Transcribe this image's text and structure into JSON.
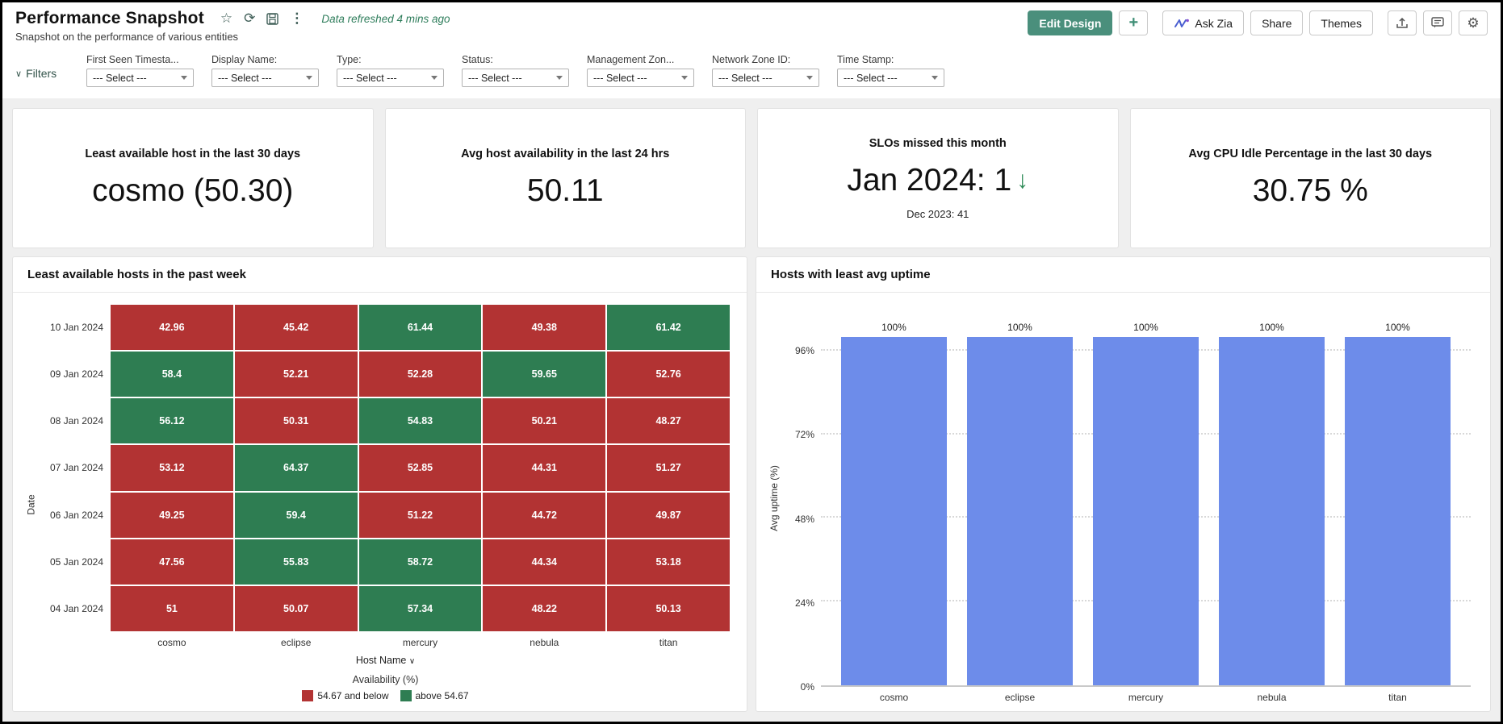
{
  "header": {
    "title": "Performance Snapshot",
    "subtitle": "Snapshot on the performance of various entities",
    "refresh_status": "Data refreshed 4 mins ago",
    "buttons": {
      "edit_design": "Edit Design",
      "add": "+",
      "ask_zia": "Ask Zia",
      "share": "Share",
      "themes": "Themes"
    },
    "icons": [
      "star-icon",
      "refresh-icon",
      "save-icon",
      "kebab-menu-icon",
      "export-icon",
      "comment-icon",
      "gear-icon"
    ]
  },
  "filters": {
    "label": "Filters",
    "select_placeholder": "--- Select ---",
    "fields": [
      "First Seen Timesta...",
      "Display Name:",
      "Type:",
      "Status:",
      "Management Zon...",
      "Network Zone ID:",
      "Time Stamp:"
    ]
  },
  "kpi_cards": [
    {
      "title": "Least available host in the last 30 days",
      "value": "cosmo (50.30)",
      "trend": "",
      "subtext": ""
    },
    {
      "title": "Avg host availability in the last 24 hrs",
      "value": "50.11",
      "trend": "",
      "subtext": ""
    },
    {
      "title": "SLOs missed this month",
      "value": "Jan 2024: 1",
      "trend": "down",
      "subtext": "Dec 2023: 41"
    },
    {
      "title": "Avg CPU Idle Percentage in the last 30 days",
      "value": "30.75 %",
      "trend": "",
      "subtext": ""
    }
  ],
  "chart_data": [
    {
      "type": "heatmap",
      "title": "Least available hosts in the past week",
      "xlabel": "Host Name",
      "ylabel": "Date",
      "columns": [
        "cosmo",
        "eclipse",
        "mercury",
        "nebula",
        "titan"
      ],
      "rows": [
        "10 Jan 2024",
        "09 Jan 2024",
        "08 Jan 2024",
        "07 Jan 2024",
        "06 Jan 2024",
        "05 Jan 2024",
        "04 Jan 2024"
      ],
      "values": [
        [
          42.96,
          45.42,
          61.44,
          49.38,
          61.42
        ],
        [
          58.4,
          52.21,
          52.28,
          59.65,
          52.76
        ],
        [
          56.12,
          50.31,
          54.83,
          50.21,
          48.27
        ],
        [
          53.12,
          64.37,
          52.85,
          44.31,
          51.27
        ],
        [
          49.25,
          59.4,
          51.22,
          44.72,
          49.87
        ],
        [
          47.56,
          55.83,
          58.72,
          44.34,
          53.18
        ],
        [
          51,
          50.07,
          57.34,
          48.22,
          50.13
        ]
      ],
      "legend": {
        "title": "Availability (%)",
        "threshold": 54.67,
        "low_label": "54.67 and below",
        "high_label": "above 54.67",
        "low_color": "#b23333",
        "high_color": "#2e7d52"
      }
    },
    {
      "type": "bar",
      "title": "Hosts with least avg uptime",
      "categories": [
        "cosmo",
        "eclipse",
        "mercury",
        "nebula",
        "titan"
      ],
      "values": [
        100,
        100,
        100,
        100,
        100
      ],
      "value_labels": [
        "100%",
        "100%",
        "100%",
        "100%",
        "100%"
      ],
      "xlabel": "",
      "ylabel": "Avg uptime (%)",
      "yticks": [
        0,
        24,
        48,
        72,
        96
      ],
      "ytick_labels": [
        "0%",
        "24%",
        "48%",
        "72%",
        "96%"
      ],
      "ylim": [
        0,
        108
      ],
      "bar_color": "#6d8cea",
      "grid": "horizontal-dashed",
      "legend_position": "none"
    }
  ],
  "colors": {
    "accent_teal": "#4a8f7c",
    "refresh_text": "#2e7d5b",
    "heat_red": "#b23333",
    "heat_green": "#2e7d52",
    "bar_blue": "#6d8cea",
    "trend_green": "#2e8b57"
  }
}
